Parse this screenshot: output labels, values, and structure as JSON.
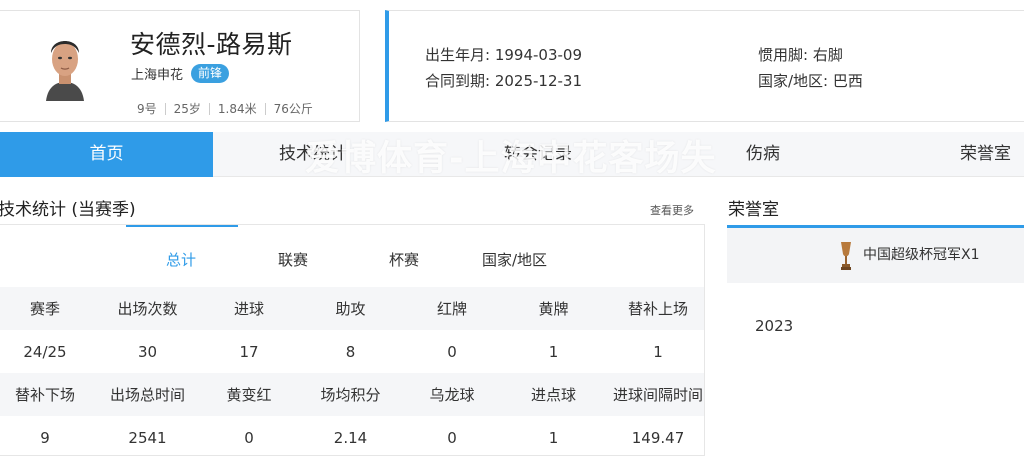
{
  "player": {
    "name": "安德烈-路易斯",
    "team": "上海申花",
    "position": "前锋",
    "number": "9号",
    "age": "25岁",
    "height": "1.84米",
    "weight": "76公斤"
  },
  "info": {
    "birth_date": "出生年月: 1994-03-09",
    "contract_expiry": "合同到期: 2025-12-31",
    "preferred_foot": "惯用脚: 右脚",
    "nationality": "国家/地区: 巴西"
  },
  "tabs": [
    {
      "label": "首页",
      "active": true
    },
    {
      "label": "技术统计"
    },
    {
      "label": "转会记录"
    },
    {
      "label": "伤病"
    },
    {
      "label": "荣誉室"
    }
  ],
  "watermark": "爱博体育-上海申花客场失",
  "stats": {
    "title": "技术统计 (当赛季)",
    "more": "查看更多",
    "sub_tabs": [
      "总计",
      "联赛",
      "杯赛",
      "国家/地区"
    ],
    "header1": [
      "赛季",
      "出场次数",
      "进球",
      "助攻",
      "红牌",
      "黄牌",
      "替补上场"
    ],
    "row1": [
      "24/25",
      "30",
      "17",
      "8",
      "0",
      "1",
      "1"
    ],
    "header2": [
      "替补下场",
      "出场总时间",
      "黄变红",
      "场均积分",
      "乌龙球",
      "进点球",
      "进球间隔时间"
    ],
    "row2": [
      "9",
      "2541",
      "0",
      "2.14",
      "0",
      "1",
      "149.47"
    ]
  },
  "honors": {
    "title": "荣誉室",
    "items": [
      {
        "label": "中国超级杯冠军X1",
        "year": "2023"
      }
    ]
  },
  "colors": {
    "accent": "#2f9be8",
    "badge": "#3aa0e0",
    "trophy": "#a56a2f"
  }
}
